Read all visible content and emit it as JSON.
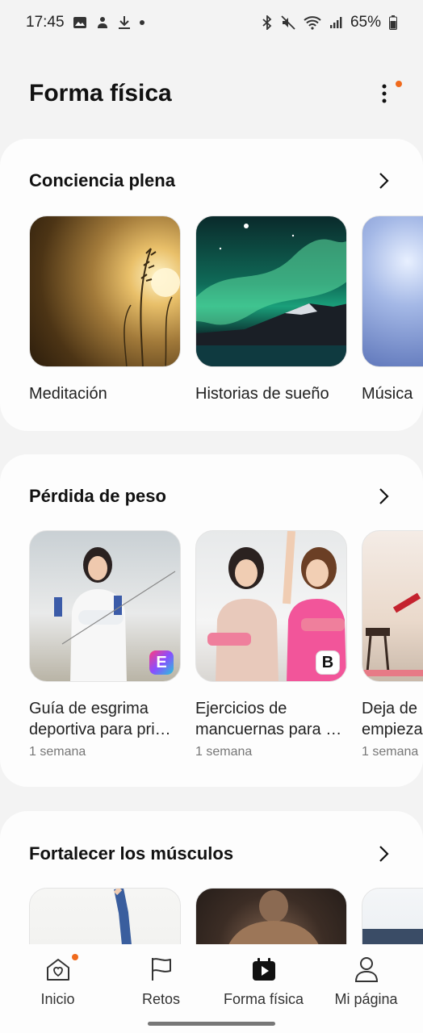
{
  "status_bar": {
    "time": "17:45",
    "battery": "65%"
  },
  "header": {
    "title": "Forma física"
  },
  "sections": [
    {
      "title": "Conciencia plena",
      "tiles": [
        {
          "label": "Meditación"
        },
        {
          "label": "Historias de sueño"
        },
        {
          "label": "Música"
        }
      ]
    },
    {
      "title": "Pérdida de peso",
      "tiles": [
        {
          "label": "Guía de esgrima deportiva para pri…",
          "meta": "1 semana"
        },
        {
          "label": "Ejercicios de mancuernas para …",
          "meta": "1 semana"
        },
        {
          "label": "Deja de empieza",
          "meta": "1 semana"
        }
      ]
    },
    {
      "title": "Fortalecer los músculos",
      "tiles": []
    }
  ],
  "badges": {
    "fencing_logo": "E",
    "dumbbell_logo": "B"
  },
  "bottom_nav": [
    {
      "label": "Inicio",
      "icon": "heart-home-icon"
    },
    {
      "label": "Retos",
      "icon": "flag-icon"
    },
    {
      "label": "Forma física",
      "icon": "play-calendar-icon"
    },
    {
      "label": "Mi página",
      "icon": "person-icon"
    }
  ],
  "colors": {
    "accent_dot": "#f06a1c"
  }
}
